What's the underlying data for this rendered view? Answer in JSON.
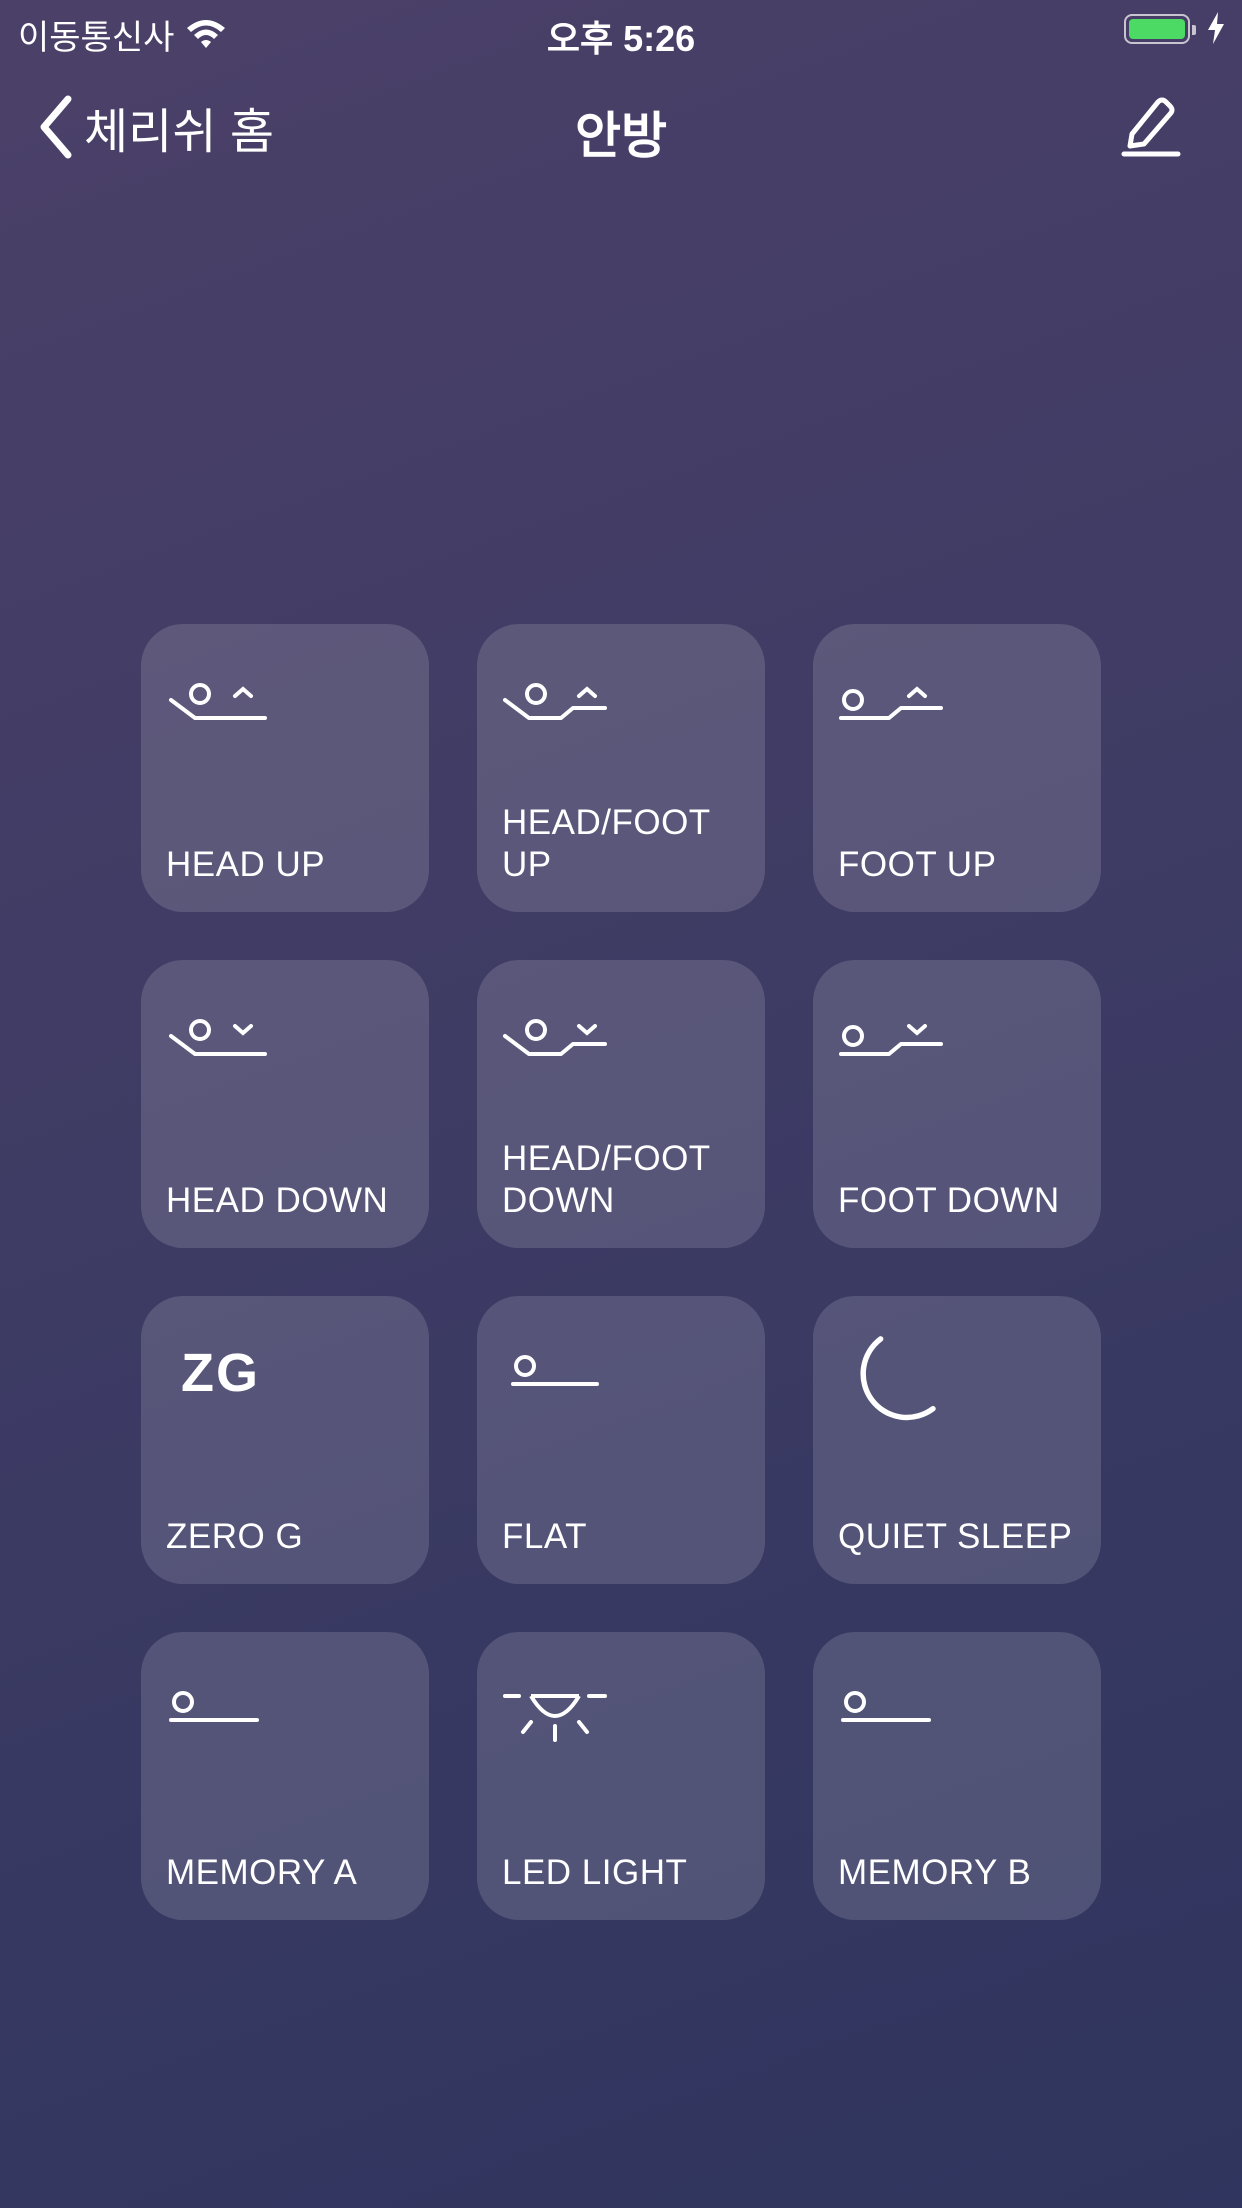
{
  "status_bar": {
    "carrier": "이동통신사",
    "time": "오후 5:26",
    "battery_color": "#4cd964"
  },
  "nav": {
    "back_label": "체리쉬 홈",
    "title": "안방"
  },
  "tiles": [
    {
      "label": "HEAD UP",
      "icon": "head-up-icon"
    },
    {
      "label": "HEAD/FOOT UP",
      "icon": "head-foot-up-icon"
    },
    {
      "label": "FOOT UP",
      "icon": "foot-up-icon"
    },
    {
      "label": "HEAD DOWN",
      "icon": "head-down-icon"
    },
    {
      "label": "HEAD/FOOT DOWN",
      "icon": "head-foot-down-icon"
    },
    {
      "label": "FOOT DOWN",
      "icon": "foot-down-icon"
    },
    {
      "label": "ZERO G",
      "icon": "zero-g-icon",
      "icon_text": "ZG"
    },
    {
      "label": "FLAT",
      "icon": "flat-icon"
    },
    {
      "label": "QUIET SLEEP",
      "icon": "moon-icon"
    },
    {
      "label": "MEMORY A",
      "icon": "memory-a-icon"
    },
    {
      "label": "LED LIGHT",
      "icon": "led-light-icon"
    },
    {
      "label": "MEMORY B",
      "icon": "memory-b-icon"
    }
  ]
}
